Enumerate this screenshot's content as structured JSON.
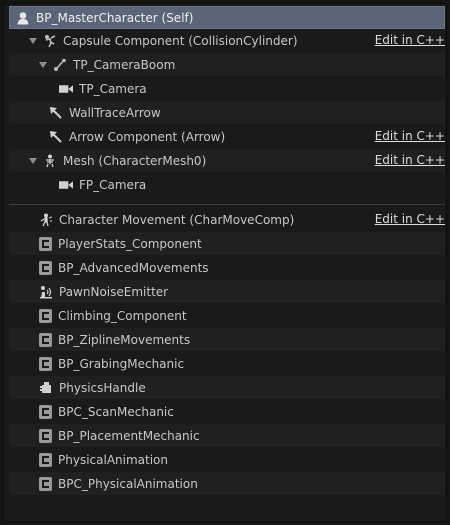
{
  "root": {
    "label": "BP_MasterCharacter (Self)",
    "icon": "character-icon"
  },
  "edit_label": "Edit in C++",
  "hierarchy": [
    {
      "label": "Capsule Component (CollisionCylinder)",
      "icon": "capsule-icon",
      "expanded": true,
      "edit": true
    },
    {
      "label": "TP_CameraBoom",
      "icon": "spring-arm-icon",
      "expanded": true,
      "edit": false
    },
    {
      "label": "TP_Camera",
      "icon": "camera-icon",
      "edit": false
    },
    {
      "label": "WallTraceArrow",
      "icon": "arrow-icon",
      "edit": false
    },
    {
      "label": "Arrow Component (Arrow)",
      "icon": "arrow-icon",
      "edit": true
    },
    {
      "label": "Mesh (CharacterMesh0)",
      "icon": "skeleton-icon",
      "expanded": true,
      "edit": true
    },
    {
      "label": "FP_Camera",
      "icon": "camera-icon",
      "edit": false
    }
  ],
  "components": [
    {
      "label": "Character Movement (CharMoveComp)",
      "icon": "movement-icon",
      "edit": true
    },
    {
      "label": "PlayerStats_Component",
      "icon": "script-component-icon"
    },
    {
      "label": "BP_AdvancedMovements",
      "icon": "script-component-icon"
    },
    {
      "label": "PawnNoiseEmitter",
      "icon": "noise-emitter-icon"
    },
    {
      "label": "Climbing_Component",
      "icon": "script-component-icon"
    },
    {
      "label": "BP_ZiplineMovements",
      "icon": "script-component-icon"
    },
    {
      "label": "BP_GrabingMechanic",
      "icon": "script-component-icon"
    },
    {
      "label": "PhysicsHandle",
      "icon": "physics-handle-icon"
    },
    {
      "label": "BPC_ScanMechanic",
      "icon": "script-component-icon"
    },
    {
      "label": "BP_PlacementMechanic",
      "icon": "script-component-icon"
    },
    {
      "label": "PhysicalAnimation",
      "icon": "script-component-icon"
    },
    {
      "label": "BPC_PhysicalAnimation",
      "icon": "script-component-icon"
    }
  ]
}
